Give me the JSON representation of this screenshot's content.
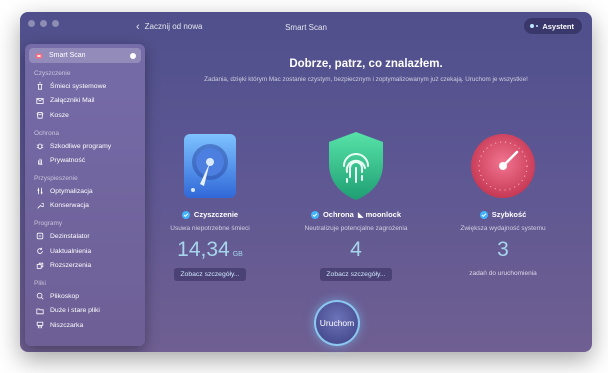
{
  "toolbar": {
    "back_label": "Zacznij od nowa",
    "title": "Smart Scan",
    "assistant_label": "Asystent"
  },
  "sidebar": {
    "active": {
      "label": "Smart Scan",
      "icon": "smart-scan-icon"
    },
    "sections": [
      {
        "title": "Czyszczenie",
        "items": [
          {
            "label": "Śmieci systemowe",
            "icon": "trash-icon"
          },
          {
            "label": "Załączniki Mail",
            "icon": "mail-icon"
          },
          {
            "label": "Kosze",
            "icon": "bin-icon"
          }
        ]
      },
      {
        "title": "Ochrona",
        "items": [
          {
            "label": "Szkodliwe programy",
            "icon": "bug-icon"
          },
          {
            "label": "Prywatność",
            "icon": "hand-icon"
          }
        ]
      },
      {
        "title": "Przyspieszenie",
        "items": [
          {
            "label": "Optymalizacja",
            "icon": "sliders-icon"
          },
          {
            "label": "Konserwacja",
            "icon": "wrench-icon"
          }
        ]
      },
      {
        "title": "Programy",
        "items": [
          {
            "label": "Dezinstalator",
            "icon": "uninstaller-icon"
          },
          {
            "label": "Uaktualnienia",
            "icon": "update-icon"
          },
          {
            "label": "Rozszerzenia",
            "icon": "extensions-icon"
          }
        ]
      },
      {
        "title": "Pliki",
        "items": [
          {
            "label": "Plikoskop",
            "icon": "space-lens-icon"
          },
          {
            "label": "Duże i stare pliki",
            "icon": "folder-icon"
          },
          {
            "label": "Niszczarka",
            "icon": "shredder-icon"
          }
        ]
      }
    ]
  },
  "main": {
    "heading": "Dobrze, patrz, co znalazłem.",
    "subheading": "Zadania, dzięki którym Mac zostanie czystym, bezpiecznym i zoptymalizowanym już czekają. Uruchom je wszystkie!",
    "cleanup": {
      "title": "Czyszczenie",
      "desc": "Usuwa niepotrzebne śmieci",
      "value": "14,34",
      "unit": "GB",
      "button": "Zobacz szczegóły...",
      "icon": "hard-drive-icon"
    },
    "protection": {
      "title": "Ochrona",
      "partner": "moonlock",
      "desc": "Neutralizuje potencjalne zagrożenia",
      "value": "4",
      "button": "Zobacz szczegóły...",
      "icon": "fingerprint-shield-icon"
    },
    "speed": {
      "title": "Szybkość",
      "desc": "Zwiększa wydajność systemu",
      "value": "3",
      "note": "zadań do uruchomienia",
      "icon": "speedometer-icon"
    },
    "run_button": "Uruchom"
  },
  "colors": {
    "accent": "#41b3ff",
    "value_text": "#aadcf0",
    "shield_green": "#3fc79a",
    "speed_red": "#e0506a"
  }
}
